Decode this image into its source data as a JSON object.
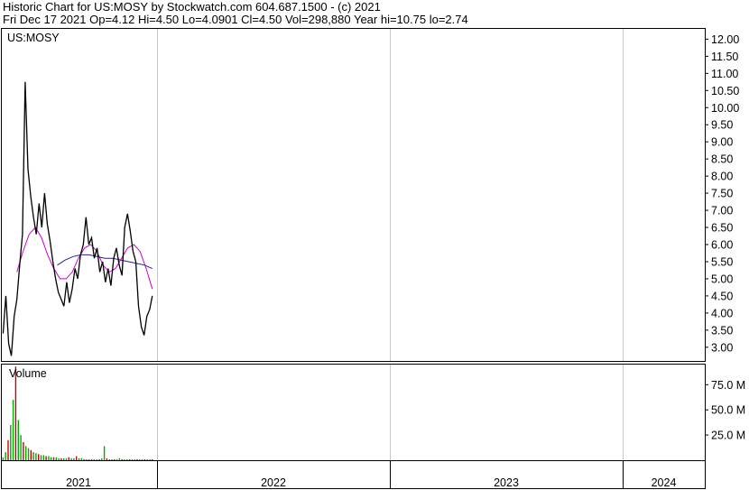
{
  "header": {
    "line1": "Historic Chart for US:MOSY by Stockwatch.com 604.687.1500 - (c) 2021",
    "line2": "Fri Dec 17 2021  Op=4.12  Hi=4.50  Lo=4.0901  Cl=4.50  Vol=298,880  Year hi=10.75  lo=2.74"
  },
  "chart_data": {
    "type": "line",
    "symbol_label": "US:MOSY",
    "volume_label": "Volume",
    "price_ylim": [
      2.6,
      12.3
    ],
    "price_ticks": [
      "12.00",
      "11.50",
      "11.00",
      "10.50",
      "10.00",
      "9.50",
      "9.00",
      "8.50",
      "8.00",
      "7.50",
      "7.00",
      "6.50",
      "6.00",
      "5.50",
      "5.00",
      "4.50",
      "4.00",
      "3.50",
      "3.00"
    ],
    "volume_ylim": [
      0,
      95
    ],
    "volume_ticks": [
      "75.0 M",
      "50.0 M",
      "25.0 M"
    ],
    "x_ticks": [
      "2021",
      "2022",
      "2023",
      "2024"
    ],
    "price_series": {
      "name": "price",
      "color": "#000000",
      "x_start": "2021-01-04",
      "x_end": "2021-12-17",
      "values": [
        3.4,
        4.5,
        3.1,
        2.75,
        3.9,
        4.4,
        5.4,
        6.3,
        10.75,
        8.2,
        7.4,
        6.8,
        6.3,
        7.2,
        6.5,
        7.5,
        6.6,
        6.1,
        5.5,
        5.0,
        4.6,
        4.4,
        4.2,
        4.9,
        4.3,
        4.7,
        5.3,
        5.0,
        5.7,
        6.0,
        6.8,
        6.0,
        6.2,
        5.6,
        5.9,
        5.2,
        5.5,
        4.9,
        5.3,
        4.8,
        5.6,
        5.9,
        5.4,
        5.1,
        6.5,
        6.9,
        6.4,
        5.8,
        5.5,
        4.2,
        3.6,
        3.35,
        3.9,
        4.1,
        4.5
      ]
    },
    "ma_series": [
      {
        "name": "ma-short",
        "color": "#cc00cc",
        "x_start": "2021-02-05",
        "values": [
          5.2,
          5.8,
          6.3,
          6.5,
          6.2,
          5.7,
          5.3,
          5.0,
          5.0,
          5.2,
          5.6,
          5.9,
          6.0,
          5.8,
          5.4,
          5.2,
          5.3,
          5.6,
          5.9,
          6.0,
          5.8,
          5.3,
          4.7
        ]
      },
      {
        "name": "ma-long",
        "color": "#222288",
        "x_start": "2021-05-10",
        "values": [
          5.4,
          5.55,
          5.65,
          5.7,
          5.7,
          5.65,
          5.6,
          5.6,
          5.55,
          5.5,
          5.45,
          5.4,
          5.3
        ]
      }
    ],
    "volume_series": {
      "name": "volume",
      "x_start": "2021-01-04",
      "values": [
        3,
        8,
        20,
        35,
        60,
        93,
        40,
        25,
        18,
        14,
        12,
        10,
        8,
        7,
        6,
        5,
        5,
        4,
        4,
        3,
        3,
        3,
        2,
        2,
        2,
        2,
        3,
        2,
        2,
        4,
        2,
        2,
        1,
        1,
        1,
        1,
        1,
        1,
        1,
        2,
        14,
        2,
        1,
        1,
        1,
        1,
        2,
        1,
        1,
        1,
        1,
        1,
        1,
        1,
        1,
        1,
        1,
        1,
        1,
        1
      ],
      "colors": [
        "#00aa00",
        "#cc0000"
      ]
    },
    "grid": true
  }
}
